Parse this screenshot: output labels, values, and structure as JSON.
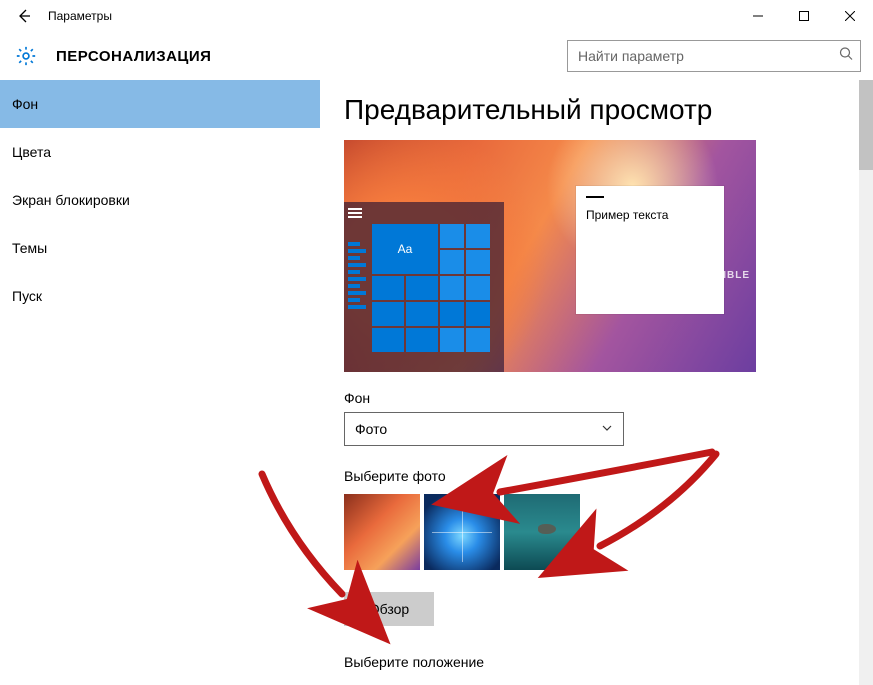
{
  "window": {
    "title": "Параметры"
  },
  "header": {
    "section_title": "ПЕРСОНАЛИЗАЦИЯ",
    "search_placeholder": "Найти параметр"
  },
  "sidebar": {
    "items": [
      {
        "label": "Фон",
        "active": true
      },
      {
        "label": "Цвета",
        "active": false
      },
      {
        "label": "Экран блокировки",
        "active": false
      },
      {
        "label": "Темы",
        "active": false
      },
      {
        "label": "Пуск",
        "active": false
      }
    ]
  },
  "main": {
    "preview_heading": "Предварительный просмотр",
    "preview_sample_text": "Пример текста",
    "preview_tile_letters": "Aa",
    "preview_badge": "EDIBLE",
    "background_label": "Фон",
    "background_dropdown_value": "Фото",
    "choose_photo_label": "Выберите фото",
    "browse_button": "Обзор",
    "choose_fit_label": "Выберите положение"
  },
  "icons": {
    "back": "back-arrow",
    "gear": "gear",
    "search": "search",
    "chevron_down": "chevron-down",
    "minimize": "minimize",
    "maximize": "maximize",
    "close": "close"
  },
  "colors": {
    "accent": "#0078d7",
    "nav_selected": "#86bae6",
    "annotation": "#c01818"
  }
}
